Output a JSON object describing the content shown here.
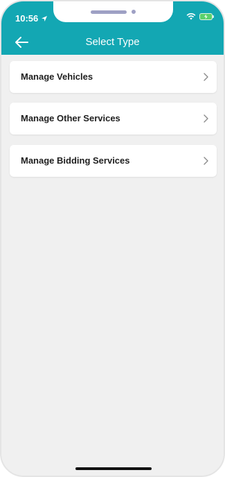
{
  "status_bar": {
    "time": "10:56",
    "icons": [
      "location-arrow-icon",
      "wifi-icon",
      "battery-charging-icon"
    ]
  },
  "header": {
    "title": "Select Type",
    "back_icon": "arrow-left-icon",
    "background_color": "#13a7b3"
  },
  "options": [
    {
      "label": "Manage Vehicles",
      "icon": "chevron-right-icon"
    },
    {
      "label": "Manage Other Services",
      "icon": "chevron-right-icon"
    },
    {
      "label": "Manage Bidding Services",
      "icon": "chevron-right-icon"
    }
  ]
}
